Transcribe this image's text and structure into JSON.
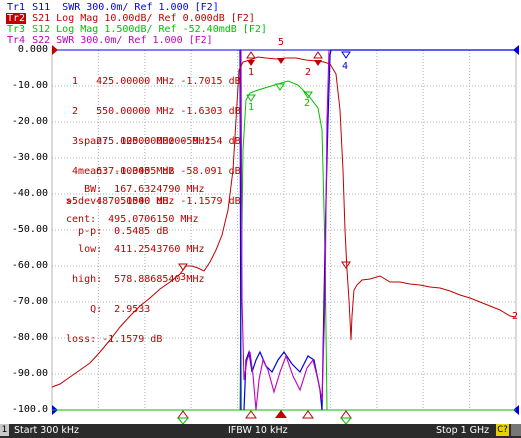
{
  "traces": [
    {
      "tag": "Tr1",
      "text": " S11  SWR 300.0m/ Ref 1.000 [F2]",
      "color": "#0000e0",
      "active": false
    },
    {
      "tag": "Tr2",
      "text": " S21 Log Mag 10.00dB/ Ref 0.000dB [F2]",
      "color": "#c00000",
      "active": true
    },
    {
      "tag": "Tr3",
      "text": " S12 Log Mag 1.500dB/ Ref -52.40mdB [F2]",
      "color": "#00c000",
      "active": false
    },
    {
      "tag": "Tr4",
      "text": " S22 SWR 300.0m/ Ref 1.000 [F2]",
      "color": "#c000c0",
      "active": false
    }
  ],
  "y_axis_labels": [
    "0.000",
    "-10.00",
    "-20.00",
    "-30.00",
    "-40.00",
    "-50.00",
    "-60.00",
    "-70.00",
    "-80.00",
    "-90.00",
    "-100.0"
  ],
  "markers_table": [
    "  1   425.00000 MHz -1.7015 dB",
    "  2   550.00000 MHz -1.6303 dB",
    "  3   275.00000 MHz -59.154 dB",
    "  4   637.00000 MHz -58.091 dB",
    " >5   487.50000 MHz -1.1579 dB"
  ],
  "stats": [
    "   span:  125.0000000 MHz",
    "   mean: -1.3455 dB",
    " s.dev:  0.1540 dB",
    "   p-p:  0.5485 dB"
  ],
  "filter_stats": [
    "    BW:  167.6324790 MHz",
    " cent:  495.0706150 MHz",
    "   low:  411.2543760 MHz",
    "  high:  578.8868540 MHz",
    "     Q:  2.9533",
    " loss: -1.1579 dB"
  ],
  "marker_labels": {
    "m1": "1",
    "m2": "2",
    "m3": "3",
    "m4": "4",
    "m5": "5"
  },
  "status_bar": {
    "channel": "1",
    "start": "Start 300 kHz",
    "ifbw": "IFBW 10 kHz",
    "stop": "Stop 1 GHz",
    "channel_badge": "C?"
  },
  "colors": {
    "s11": "#0000e0",
    "s21": "#c00000",
    "s12": "#00c000",
    "s22": "#c000c0",
    "grid": "#b4b4b4"
  }
}
